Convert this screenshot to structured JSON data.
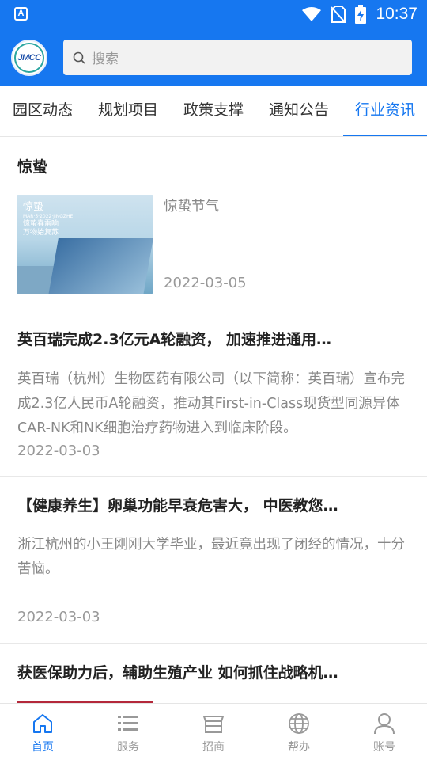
{
  "statusbar": {
    "time": "10:37",
    "app_badge": "A"
  },
  "header": {
    "logo_text": "JMCC",
    "search_placeholder": "搜索"
  },
  "tabs": [
    {
      "label": "园区动态",
      "active": false
    },
    {
      "label": "规划项目",
      "active": false
    },
    {
      "label": "政策支撑",
      "active": false
    },
    {
      "label": "通知公告",
      "active": false
    },
    {
      "label": "行业资讯",
      "active": true
    }
  ],
  "articles": [
    {
      "title": "惊蛰",
      "summary": "惊蛰节气",
      "date": "2022-03-05",
      "thumbnail": {
        "lines": [
          "惊蛰",
          "MAR·5·2022·JINGZHE",
          "惊蛰春雷响",
          "万物始复苏"
        ]
      }
    },
    {
      "title": "英百瑞完成2.3亿元A轮融资， 加速推进通用…",
      "summary": "英百瑞（杭州）生物医药有限公司（以下简称：英百瑞）宣布完成2.3亿人民币A轮融资，推动其First-in-Class现货型同源异体CAR-NK和NK细胞治疗药物进入到临床阶段。",
      "date": "2022-03-03"
    },
    {
      "title": "【健康养生】卵巢功能早衰危害大， 中医教您…",
      "summary": "浙江杭州的小王刚刚大学毕业，最近竟出现了闭经的情况，十分苦恼。",
      "date": "2022-03-03"
    },
    {
      "title": "获医保助力后，辅助生殖产业 如何抓住战略机…",
      "summary": "",
      "date": ""
    }
  ],
  "bottom_nav": [
    {
      "label": "首页",
      "icon": "home-icon",
      "active": true
    },
    {
      "label": "服务",
      "icon": "list-icon",
      "active": false
    },
    {
      "label": "招商",
      "icon": "store-icon",
      "active": false
    },
    {
      "label": "帮办",
      "icon": "globe-icon",
      "active": false
    },
    {
      "label": "账号",
      "icon": "user-icon",
      "active": false
    }
  ],
  "colors": {
    "primary": "#1677f0",
    "muted": "#999999"
  }
}
